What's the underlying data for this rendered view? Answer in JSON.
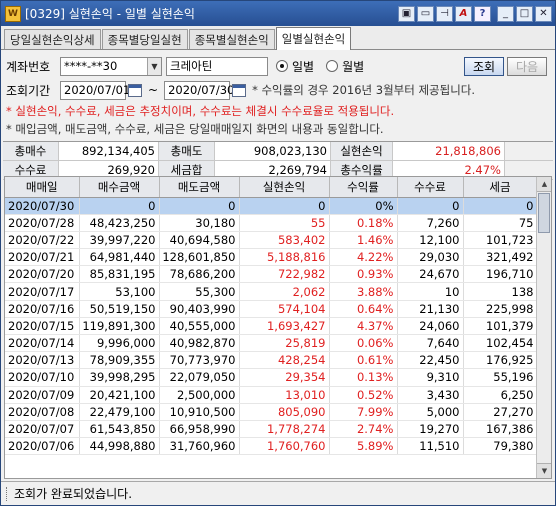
{
  "window": {
    "title": "[0329] 실현손익 - 일별 실현손익",
    "icon_text": "W"
  },
  "tabs": [
    "당일실현손익상세",
    "종목별당일실현",
    "종목별실현손익",
    "일별실현손익"
  ],
  "controls": {
    "account_label": "계좌번호",
    "account_number": "****-**30",
    "account_name": "크레아틴",
    "radio_daily": "일별",
    "radio_monthly": "월별",
    "btn_query": "조회",
    "btn_next": "다음",
    "period_label": "조회기간",
    "date_from": "2020/07/01",
    "tilde": "~",
    "date_to": "2020/07/30",
    "period_note": "* 수익률의 경우 2016년 3월부터 제공됩니다."
  },
  "notices": {
    "red": "* 실현손익, 수수료, 세금은 추정치이며, 수수료는 체결시 수수료율로 적용됩니다.",
    "gray": "* 매입금액, 매도금액, 수수료, 세금은 당일매매일지 화면의 내용과 동일합니다."
  },
  "summary": {
    "total_buy_label": "총매수",
    "total_buy": "892,134,405",
    "total_sell_label": "총매도",
    "total_sell": "908,023,130",
    "realized_label": "실현손익",
    "realized": "21,818,806",
    "fee_label": "수수료",
    "fee": "269,920",
    "tax_label": "세금합",
    "tax": "2,269,794",
    "return_label": "총수익률",
    "return": "2.47%"
  },
  "columns": [
    "매매일",
    "매수금액",
    "매도금액",
    "실현손익",
    "수익률",
    "수수료",
    "세금"
  ],
  "rows": [
    {
      "date": "2020/07/30",
      "buy": "0",
      "sell": "0",
      "pnl": "0",
      "rate": "0%",
      "fee": "0",
      "tax": "0",
      "red": false
    },
    {
      "date": "2020/07/28",
      "buy": "48,423,250",
      "sell": "30,180",
      "pnl": "55",
      "rate": "0.18%",
      "fee": "7,260",
      "tax": "75",
      "red": true
    },
    {
      "date": "2020/07/22",
      "buy": "39,997,220",
      "sell": "40,694,580",
      "pnl": "583,402",
      "rate": "1.46%",
      "fee": "12,100",
      "tax": "101,723",
      "red": true
    },
    {
      "date": "2020/07/21",
      "buy": "64,981,440",
      "sell": "128,601,850",
      "pnl": "5,188,816",
      "rate": "4.22%",
      "fee": "29,030",
      "tax": "321,492",
      "red": true
    },
    {
      "date": "2020/07/20",
      "buy": "85,831,195",
      "sell": "78,686,200",
      "pnl": "722,982",
      "rate": "0.93%",
      "fee": "24,670",
      "tax": "196,710",
      "red": true
    },
    {
      "date": "2020/07/17",
      "buy": "53,100",
      "sell": "55,300",
      "pnl": "2,062",
      "rate": "3.88%",
      "fee": "10",
      "tax": "138",
      "red": true
    },
    {
      "date": "2020/07/16",
      "buy": "50,519,150",
      "sell": "90,403,990",
      "pnl": "574,104",
      "rate": "0.64%",
      "fee": "21,130",
      "tax": "225,998",
      "red": true
    },
    {
      "date": "2020/07/15",
      "buy": "119,891,300",
      "sell": "40,555,000",
      "pnl": "1,693,427",
      "rate": "4.37%",
      "fee": "24,060",
      "tax": "101,379",
      "red": true
    },
    {
      "date": "2020/07/14",
      "buy": "9,996,000",
      "sell": "40,982,870",
      "pnl": "25,819",
      "rate": "0.06%",
      "fee": "7,640",
      "tax": "102,454",
      "red": true
    },
    {
      "date": "2020/07/13",
      "buy": "78,909,355",
      "sell": "70,773,970",
      "pnl": "428,254",
      "rate": "0.61%",
      "fee": "22,450",
      "tax": "176,925",
      "red": true
    },
    {
      "date": "2020/07/10",
      "buy": "39,998,295",
      "sell": "22,079,050",
      "pnl": "29,354",
      "rate": "0.13%",
      "fee": "9,310",
      "tax": "55,196",
      "red": true
    },
    {
      "date": "2020/07/09",
      "buy": "20,421,100",
      "sell": "2,500,000",
      "pnl": "13,010",
      "rate": "0.52%",
      "fee": "3,430",
      "tax": "6,250",
      "red": true
    },
    {
      "date": "2020/07/08",
      "buy": "22,479,100",
      "sell": "10,910,500",
      "pnl": "805,090",
      "rate": "7.99%",
      "fee": "5,000",
      "tax": "27,270",
      "red": true
    },
    {
      "date": "2020/07/07",
      "buy": "61,543,850",
      "sell": "66,958,990",
      "pnl": "1,778,274",
      "rate": "2.74%",
      "fee": "19,270",
      "tax": "167,386",
      "red": true
    },
    {
      "date": "2020/07/06",
      "buy": "44,998,880",
      "sell": "31,760,960",
      "pnl": "1,760,760",
      "rate": "5.89%",
      "fee": "11,510",
      "tax": "79,380",
      "red": true
    }
  ],
  "status": {
    "message": "조회가 완료되었습니다."
  }
}
